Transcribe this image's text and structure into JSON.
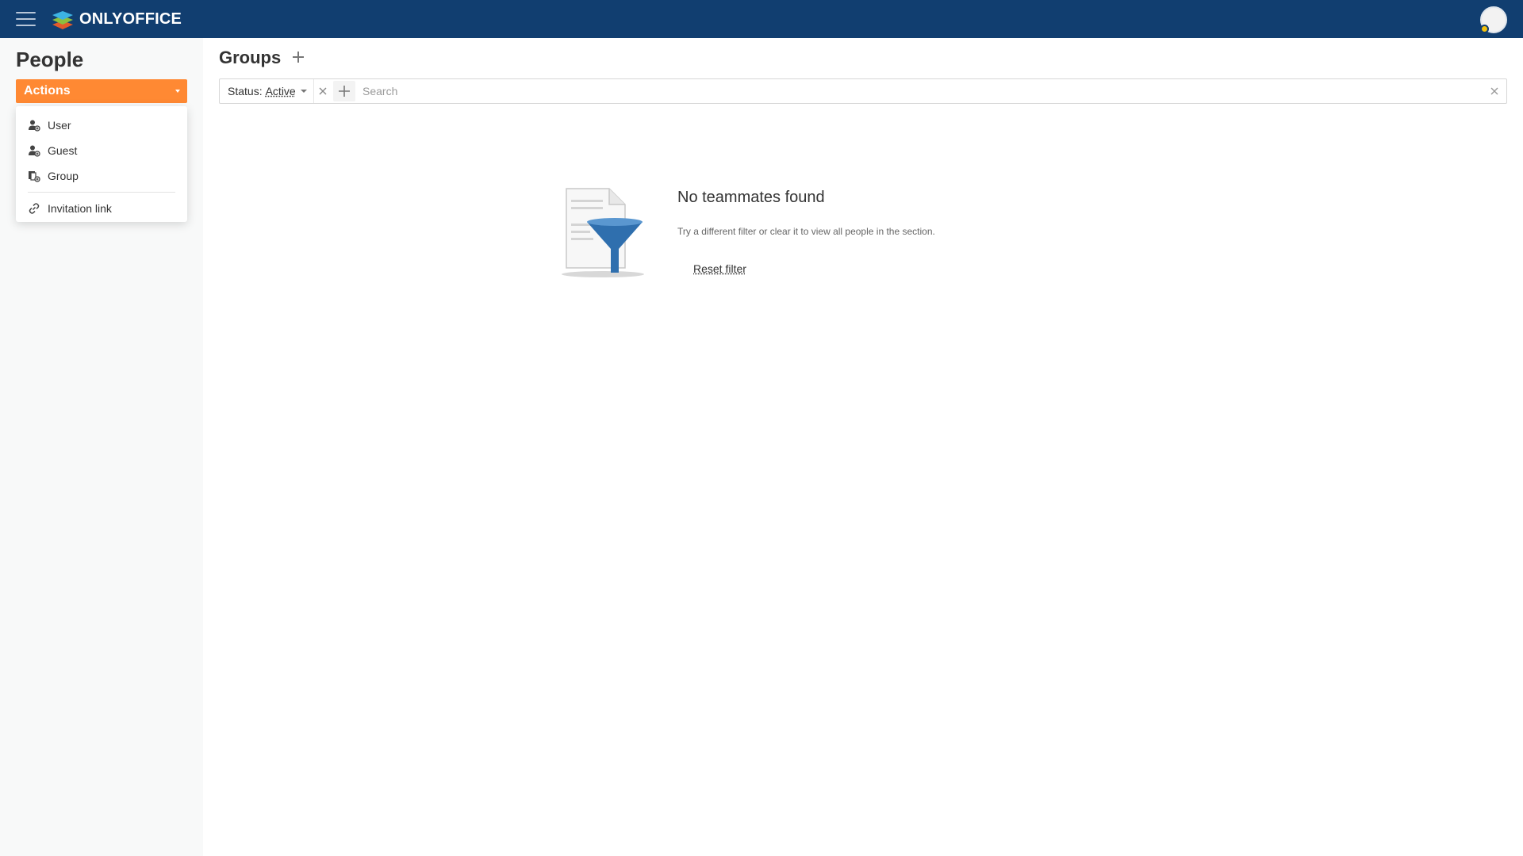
{
  "topbar": {
    "logo_text": "ONLYOFFICE",
    "colors": {
      "background": "#113e70",
      "avatar_status": "#f2c10e"
    }
  },
  "sidebar": {
    "title": "People",
    "actions_label": "Actions",
    "actions_color": "#ff8933",
    "menu": [
      {
        "label": "User",
        "icon": "add-user-icon"
      },
      {
        "label": "Guest",
        "icon": "add-guest-icon"
      },
      {
        "label": "Group",
        "icon": "add-group-icon"
      },
      {
        "label": "Invitation link",
        "icon": "link-icon"
      }
    ]
  },
  "main": {
    "title": "Groups",
    "filter": {
      "label": "Status:",
      "value": "Active",
      "search_placeholder": "Search"
    },
    "empty": {
      "title": "No teammates found",
      "subtitle": "Try a different filter or clear it to view all people in the section.",
      "reset_label": "Reset filter"
    }
  }
}
